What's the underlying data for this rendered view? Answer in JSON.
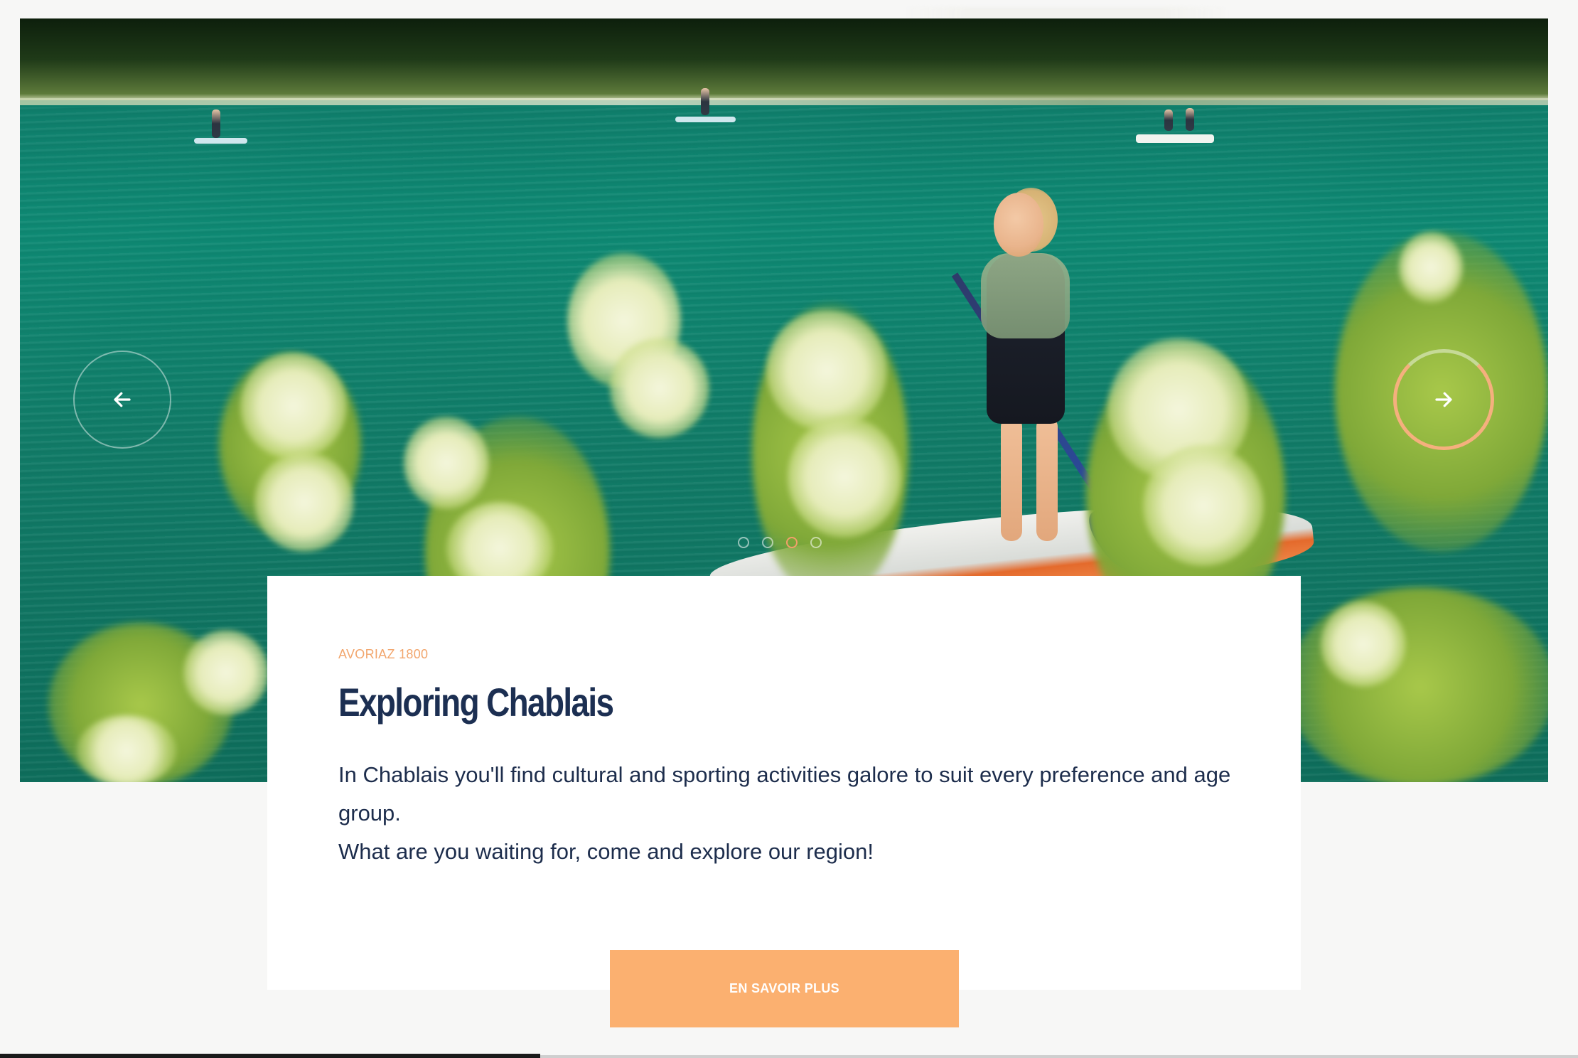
{
  "hero": {
    "image_alt": "Woman paddleboarding on a green lake with wildflowers in the foreground"
  },
  "carousel": {
    "prev_icon": "arrow-left-icon",
    "next_icon": "arrow-right-icon",
    "dots_count": 4,
    "active_dot": 3,
    "accent_color": "#f5b07e"
  },
  "card": {
    "tag": "AVORIAZ 1800",
    "title": "Exploring Chablais",
    "paragraph_1": "In Chablais you'll find cultural and sporting activities galore to suit every preference and age group.",
    "paragraph_2": "What are you waiting for, come and explore our region!",
    "cta_label": "EN SAVOIR PLUS"
  },
  "colors": {
    "title": "#1c2f52",
    "tag": "#f2a66d",
    "cta_bg": "#fbb070"
  }
}
